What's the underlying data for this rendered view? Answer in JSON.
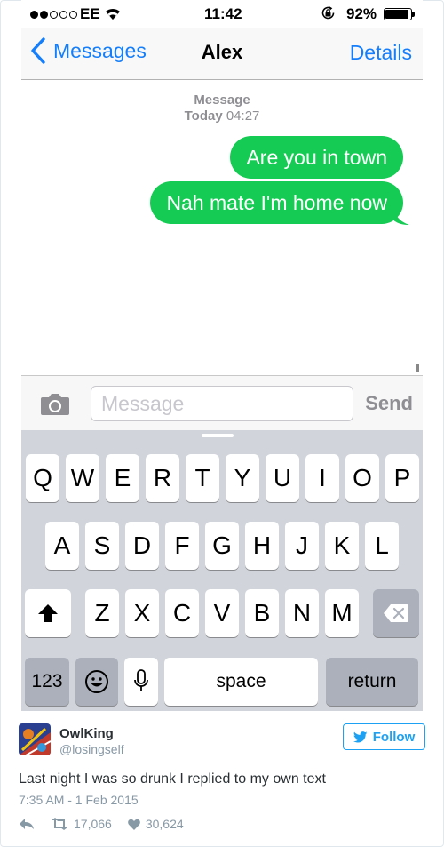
{
  "status_bar": {
    "signal_dots_filled": 2,
    "signal_dots_total": 5,
    "carrier": "EE",
    "time": "11:42",
    "battery_percent": "92%",
    "battery_level": 0.92
  },
  "nav": {
    "back_label": "Messages",
    "title": "Alex",
    "details_label": "Details"
  },
  "thread": {
    "header_service": "Message",
    "header_day": "Today",
    "header_time": "04:27",
    "messages": [
      {
        "text": "Are you in town",
        "sender": "me"
      },
      {
        "text": "Nah mate I'm home now",
        "sender": "me"
      }
    ]
  },
  "composer": {
    "placeholder": "Message",
    "value": "",
    "send_label": "Send"
  },
  "keyboard": {
    "row1": [
      "Q",
      "W",
      "E",
      "R",
      "T",
      "Y",
      "U",
      "I",
      "O",
      "P"
    ],
    "row2": [
      "A",
      "S",
      "D",
      "F",
      "G",
      "H",
      "J",
      "K",
      "L"
    ],
    "row3": [
      "Z",
      "X",
      "C",
      "V",
      "B",
      "N",
      "M"
    ],
    "numbers_label": "123",
    "space_label": "space",
    "return_label": "return"
  },
  "tweet": {
    "display_name": "OwlKing",
    "handle": "@losingself",
    "follow_label": "Follow",
    "text": "Last night I was so drunk I replied to my own text",
    "timestamp": "7:35 AM - 1 Feb 2015",
    "retweets": "17,066",
    "likes": "30,624"
  },
  "colors": {
    "ios_blue": "#147efb",
    "bubble_green": "#15cb54",
    "twitter_blue": "#1da1f2",
    "keyboard_bg": "#d1d5db"
  }
}
